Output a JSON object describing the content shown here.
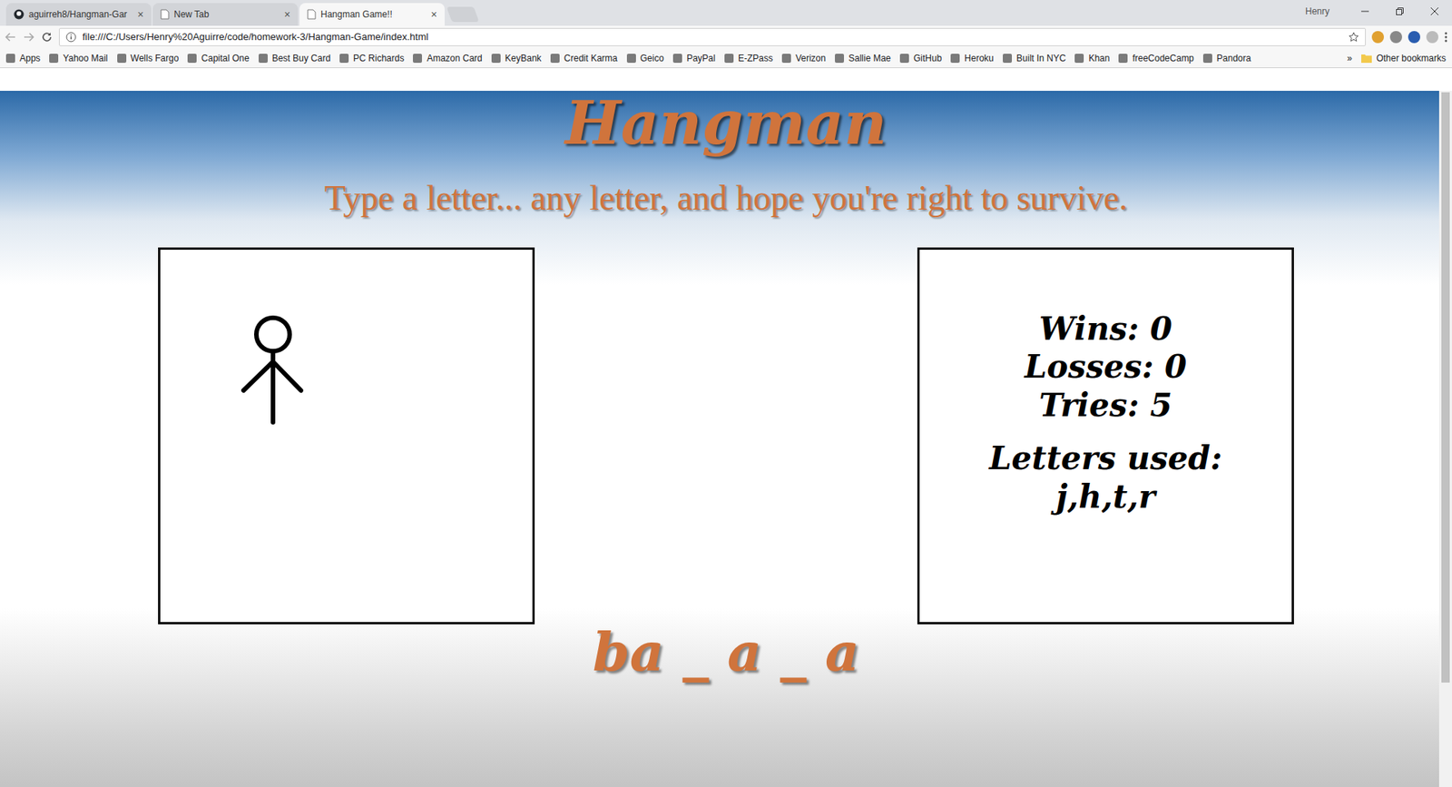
{
  "browser": {
    "tabs": [
      {
        "label": "aguirreh8/Hangman-Gar",
        "close": "×",
        "selected": false
      },
      {
        "label": "New Tab",
        "close": "×",
        "selected": false
      },
      {
        "label": "Hangman Game!!",
        "close": "×",
        "selected": true
      }
    ],
    "profile": "Henry",
    "address": "file:///C:/Users/Henry%20Aguirre/code/homework-3/Hangman-Game/index.html",
    "bookmarks": [
      "Apps",
      "Yahoo Mail",
      "Wells Fargo",
      "Capital One",
      "Best Buy Card",
      "PC Richards",
      "Amazon Card",
      "KeyBank",
      "Credit Karma",
      "Geico",
      "PayPal",
      "E-ZPass",
      "Verizon",
      "Sallie Mae",
      "GitHub",
      "Heroku",
      "Built In NYC",
      "Khan",
      "freeCodeCamp",
      "Pandora"
    ],
    "more_bookmarks": "»",
    "other_bookmarks": "Other bookmarks"
  },
  "page": {
    "title": "Hangman",
    "subtitle": "Type a letter... any letter, and hope you're right to survive.",
    "figure": {
      "head": true,
      "body": true,
      "left_arm": true,
      "right_arm": true,
      "left_leg": false,
      "right_leg": false
    },
    "stats": [
      "Wins: 0",
      "Losses: 0",
      "Tries: 5"
    ],
    "letters_label": "Letters used:",
    "letters_used": "j,h,t,r",
    "word": "ba _ a _ a"
  }
}
